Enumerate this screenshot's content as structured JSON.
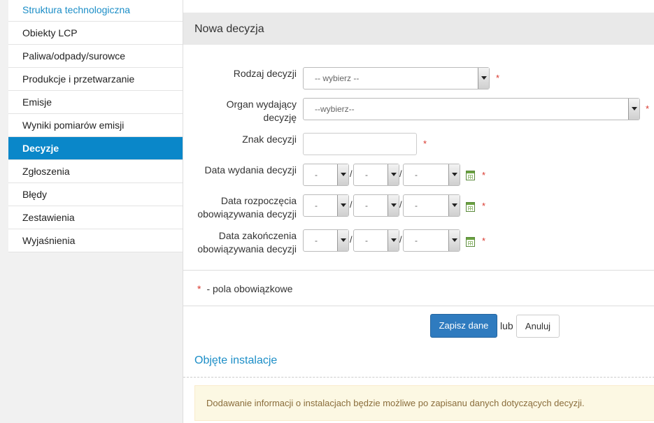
{
  "sidebar": {
    "items": [
      {
        "label": "Struktura technologiczna"
      },
      {
        "label": "Obiekty LCP"
      },
      {
        "label": "Paliwa/odpady/surowce"
      },
      {
        "label": "Produkcje i przetwarzanie"
      },
      {
        "label": "Emisje"
      },
      {
        "label": "Wyniki pomiarów emisji"
      },
      {
        "label": "Decyzje"
      },
      {
        "label": "Zgłoszenia"
      },
      {
        "label": "Błędy"
      },
      {
        "label": "Zestawienia"
      },
      {
        "label": "Wyjaśnienia"
      }
    ],
    "active_label": "Decyzje"
  },
  "panel": {
    "title": "Nowa decyzja"
  },
  "form": {
    "rodzaj": {
      "label": "Rodzaj decyzji",
      "value": "-- wybierz --"
    },
    "organ": {
      "label_line1": "Organ wydający",
      "label_line2": "decyzję",
      "value": "--wybierz--"
    },
    "znak": {
      "label": "Znak decyzji",
      "value": ""
    },
    "data_wydania": {
      "label": "Data wydania decyzji",
      "day": "-",
      "month": "-",
      "year": "-"
    },
    "data_rozpoczecia": {
      "label_line1": "Data rozpoczęcia",
      "label_line2": "obowiązywania decyzji",
      "day": "-",
      "month": "-",
      "year": "-"
    },
    "data_zakonczenia": {
      "label_line1": "Data zakończenia",
      "label_line2": "obowiązywania decyzji",
      "day": "-",
      "month": "-",
      "year": "-"
    },
    "required_mark": "*",
    "date_separator": "/"
  },
  "legend": {
    "mark": "*",
    "text": "- pola obowiązkowe"
  },
  "actions": {
    "save_label": "Zapisz dane",
    "or_label": "lub",
    "cancel_label": "Anuluj"
  },
  "installations": {
    "title": "Objęte instalacje",
    "info": "Dodawanie informacji o instalacjach będzie możliwe po zapisanu danych dotyczących decyzji."
  },
  "colors": {
    "accent": "#0a87c9",
    "link": "#1c8ec7",
    "required": "#d9382e",
    "primary_button": "#2f7bbf"
  }
}
